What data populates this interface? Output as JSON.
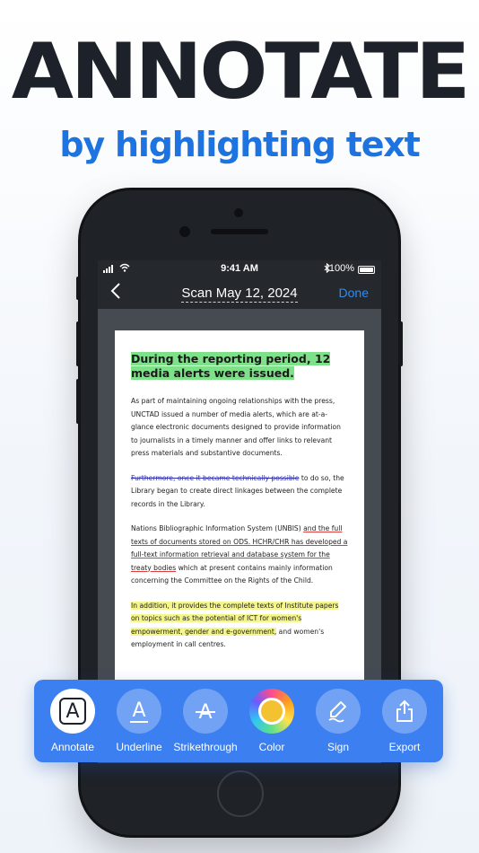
{
  "headline": "ANNOTATE",
  "subheadline": "by highlighting text",
  "status_bar": {
    "time": "9:41 AM",
    "battery": "100%"
  },
  "nav": {
    "back_icon": "chevron-left-icon",
    "title": "Scan May 12, 2024",
    "done_label": "Done"
  },
  "document": {
    "heading": "During the reporting period, 12 media alerts were issued.",
    "para1": "As part of maintaining ongoing relationships with the press, UNCTAD issued a number of media alerts, which are at-a-glance electronic documents designed to provide information to journalists in a timely manner and offer links to relevant press materials and substantive documents.",
    "para2_strike": "Furthermore, once it became technically possible",
    "para2_rest": "to do so, the Library began to create direct linkages between the complete records in the Library.",
    "para3_line1": "Nations Bibliographic Information System (UNBIS)",
    "para3_underline": "and the full texts of documents stored on ODS. HCHR/CHR has developed a full-text information retrieval and database system for the treaty bodies",
    "para3_rest": "which at present contains mainly information concerning the Committee on the Rights of the Child.",
    "para4_highlight": "In addition, it provides the complete texts of Institute papers on topics such as the potential of ICT for women's empowerment, gender and e-government,",
    "para4_rest": "and women's employment in call centres."
  },
  "toolbar": {
    "items": [
      {
        "label": "Annotate",
        "icon": "annotate-icon"
      },
      {
        "label": "Underline",
        "icon": "underline-icon"
      },
      {
        "label": "Strikethrough",
        "icon": "strikethrough-icon"
      },
      {
        "label": "Color",
        "icon": "color-picker-icon"
      },
      {
        "label": "Sign",
        "icon": "sign-pen-icon"
      },
      {
        "label": "Export",
        "icon": "share-export-icon"
      }
    ]
  },
  "colors": {
    "accent": "#3c7ff0",
    "headline": "#1d222a",
    "subheadline": "#1d73e0",
    "highlight_green": "#7fe08a",
    "highlight_yellow": "#f4f58a",
    "strike": "#2d2fb0",
    "underline": "#e23b3b"
  }
}
